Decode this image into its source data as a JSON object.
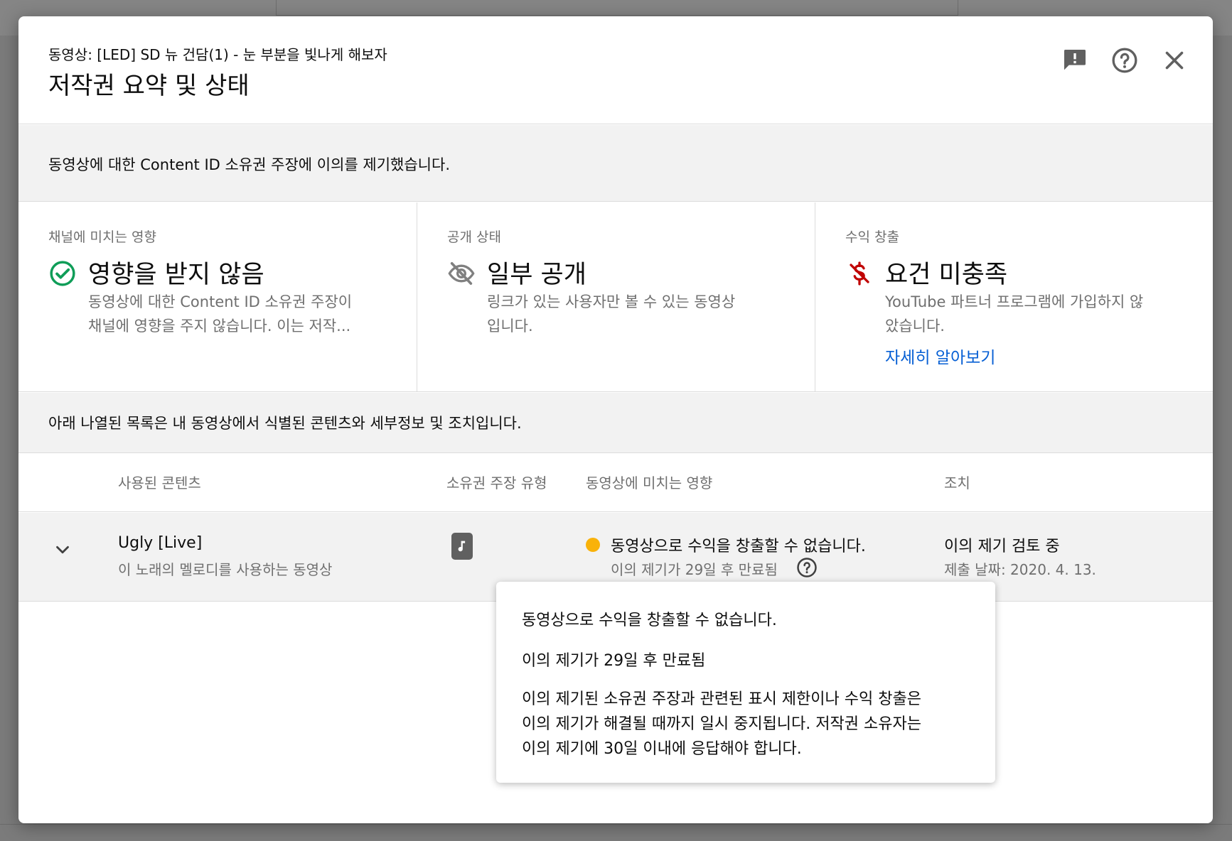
{
  "colors": {
    "accent_link": "#065fd4",
    "success": "#0f9d58",
    "error": "#c00000",
    "status_dot": "#f9b20a",
    "muted_text": "#6f6f6f",
    "banner_bg": "#f2f2f2"
  },
  "header": {
    "subtitle": "동영상: [LED] SD 뉴 건담(1) - 눈 부분을 빛나게 해보자",
    "title": "저작권 요약 및 상태",
    "icons": [
      "feedback-icon",
      "help-icon",
      "close-icon"
    ]
  },
  "banner": {
    "text": "동영상에 대한 Content ID 소유권 주장에 이의를 제기했습니다."
  },
  "cards": [
    {
      "label": "채널에 미치는 영향",
      "icon": "check-circle-icon",
      "value": "영향을 받지 않음",
      "description": [
        "동영상에 대한 Content ID 소유권 주장이",
        "채널에 영향을 주지 않습니다. 이는 저작..."
      ]
    },
    {
      "label": "공개 상태",
      "icon": "eye-off-icon",
      "value": "일부 공개",
      "description": [
        "링크가 있는 사용자만 볼 수 있는 동영상",
        "입니다."
      ]
    },
    {
      "label": "수익 창출",
      "icon": "money-off-icon",
      "value": "요건 미충족",
      "description": [
        "YouTube 파트너 프로그램에 가입하지 않",
        "았습니다."
      ],
      "link": "자세히 알아보기"
    }
  ],
  "list_intro": "아래 나열된 목록은 내 동영상에서 식별된 콘텐츠와 세부정보 및 조치입니다.",
  "table": {
    "headers": [
      "사용된 콘텐츠",
      "소유권 주장 유형",
      "동영상에 미치는 영향",
      "조치"
    ],
    "rows": [
      {
        "content_title": "Ugly [Live]",
        "content_sub": "이 노래의 멜로디를 사용하는 동영상",
        "claim_type_icon": "music-note-icon",
        "impact": "동영상으로 수익을 창출할 수 없습니다.",
        "impact_sub": "이의 제기가 29일 후 만료됨",
        "action": "이의 제기 검토 중",
        "action_sub": "제출 날짜: 2020. 4. 13."
      }
    ]
  },
  "tooltip": {
    "line1": "동영상으로 수익을 창출할 수 없습니다.",
    "line2": "이의 제기가 29일 후 만료됨",
    "para": [
      "이의 제기된 소유권 주장과 관련된 표시 제한이나 수익 창출은",
      "이의 제기가 해결될 때까지 일시 중지됩니다. 저작권 소유자는",
      "이의 제기에 30일 이내에 응답해야 합니다."
    ]
  }
}
